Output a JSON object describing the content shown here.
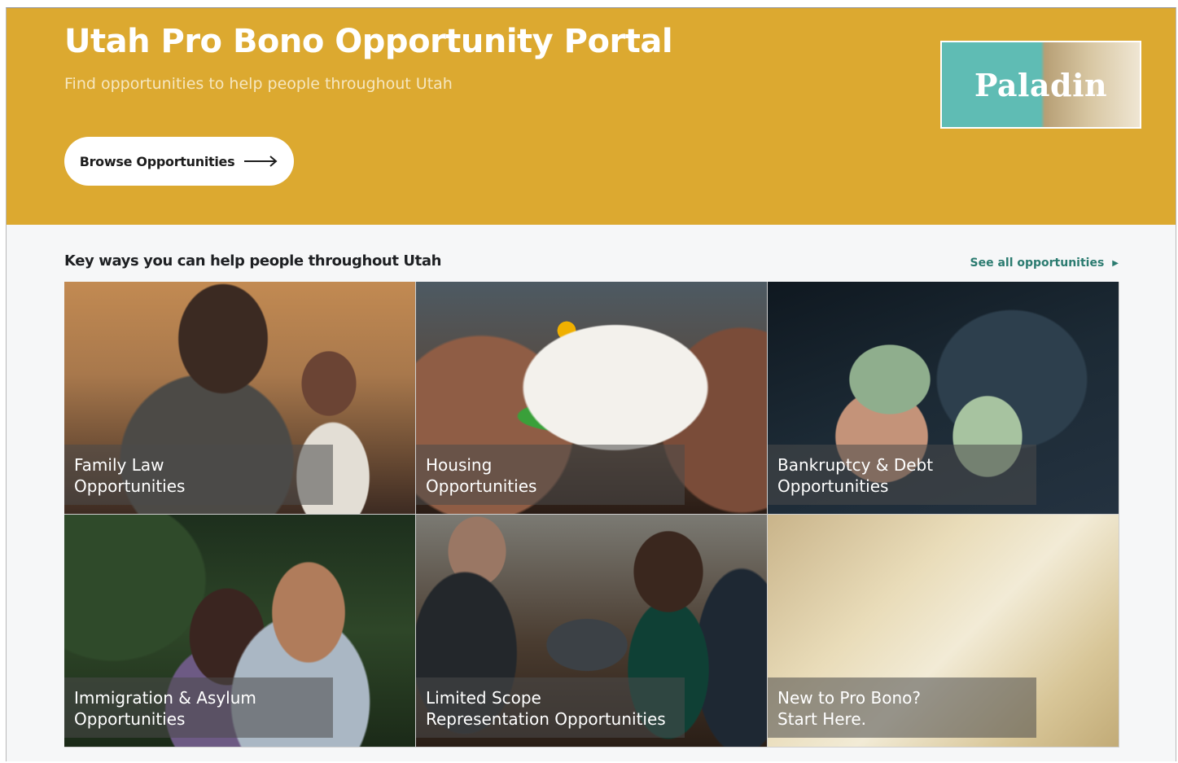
{
  "hero": {
    "title": "Utah Pro Bono Opportunity Portal",
    "subtitle": "Find opportunities to help people throughout Utah",
    "browse_label": "Browse Opportunities",
    "browse_icon": "arrow-right-icon",
    "logo_text": "Paladin",
    "background_color": "#dca930"
  },
  "section": {
    "title": "Key ways you can help people throughout Utah",
    "see_all_label": "See all opportunities",
    "see_all_icon": "triangle-right-icon",
    "link_color": "#2b7b70"
  },
  "tiles": [
    {
      "line1": "Family Law",
      "line2": "Opportunities"
    },
    {
      "line1": "Housing",
      "line2": "Opportunities"
    },
    {
      "line1": "Bankruptcy & Debt",
      "line2": "Opportunities"
    },
    {
      "line1": "Immigration & Asylum",
      "line2": "Opportunities"
    },
    {
      "line1": "Limited Scope",
      "line2": "Representation Opportunities"
    },
    {
      "line1": "New to Pro Bono?",
      "line2": "Start Here."
    }
  ]
}
